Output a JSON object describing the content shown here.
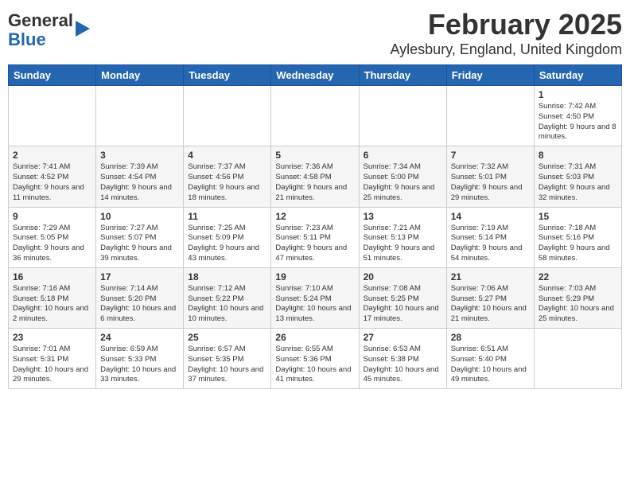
{
  "logo": {
    "general": "General",
    "blue": "Blue"
  },
  "title": "February 2025",
  "subtitle": "Aylesbury, England, United Kingdom",
  "headers": [
    "Sunday",
    "Monday",
    "Tuesday",
    "Wednesday",
    "Thursday",
    "Friday",
    "Saturday"
  ],
  "weeks": [
    [
      {
        "day": "",
        "detail": ""
      },
      {
        "day": "",
        "detail": ""
      },
      {
        "day": "",
        "detail": ""
      },
      {
        "day": "",
        "detail": ""
      },
      {
        "day": "",
        "detail": ""
      },
      {
        "day": "",
        "detail": ""
      },
      {
        "day": "1",
        "detail": "Sunrise: 7:42 AM\nSunset: 4:50 PM\nDaylight: 9 hours and 8 minutes."
      }
    ],
    [
      {
        "day": "2",
        "detail": "Sunrise: 7:41 AM\nSunset: 4:52 PM\nDaylight: 9 hours and 11 minutes."
      },
      {
        "day": "3",
        "detail": "Sunrise: 7:39 AM\nSunset: 4:54 PM\nDaylight: 9 hours and 14 minutes."
      },
      {
        "day": "4",
        "detail": "Sunrise: 7:37 AM\nSunset: 4:56 PM\nDaylight: 9 hours and 18 minutes."
      },
      {
        "day": "5",
        "detail": "Sunrise: 7:36 AM\nSunset: 4:58 PM\nDaylight: 9 hours and 21 minutes."
      },
      {
        "day": "6",
        "detail": "Sunrise: 7:34 AM\nSunset: 5:00 PM\nDaylight: 9 hours and 25 minutes."
      },
      {
        "day": "7",
        "detail": "Sunrise: 7:32 AM\nSunset: 5:01 PM\nDaylight: 9 hours and 29 minutes."
      },
      {
        "day": "8",
        "detail": "Sunrise: 7:31 AM\nSunset: 5:03 PM\nDaylight: 9 hours and 32 minutes."
      }
    ],
    [
      {
        "day": "9",
        "detail": "Sunrise: 7:29 AM\nSunset: 5:05 PM\nDaylight: 9 hours and 36 minutes."
      },
      {
        "day": "10",
        "detail": "Sunrise: 7:27 AM\nSunset: 5:07 PM\nDaylight: 9 hours and 39 minutes."
      },
      {
        "day": "11",
        "detail": "Sunrise: 7:25 AM\nSunset: 5:09 PM\nDaylight: 9 hours and 43 minutes."
      },
      {
        "day": "12",
        "detail": "Sunrise: 7:23 AM\nSunset: 5:11 PM\nDaylight: 9 hours and 47 minutes."
      },
      {
        "day": "13",
        "detail": "Sunrise: 7:21 AM\nSunset: 5:13 PM\nDaylight: 9 hours and 51 minutes."
      },
      {
        "day": "14",
        "detail": "Sunrise: 7:19 AM\nSunset: 5:14 PM\nDaylight: 9 hours and 54 minutes."
      },
      {
        "day": "15",
        "detail": "Sunrise: 7:18 AM\nSunset: 5:16 PM\nDaylight: 9 hours and 58 minutes."
      }
    ],
    [
      {
        "day": "16",
        "detail": "Sunrise: 7:16 AM\nSunset: 5:18 PM\nDaylight: 10 hours and 2 minutes."
      },
      {
        "day": "17",
        "detail": "Sunrise: 7:14 AM\nSunset: 5:20 PM\nDaylight: 10 hours and 6 minutes."
      },
      {
        "day": "18",
        "detail": "Sunrise: 7:12 AM\nSunset: 5:22 PM\nDaylight: 10 hours and 10 minutes."
      },
      {
        "day": "19",
        "detail": "Sunrise: 7:10 AM\nSunset: 5:24 PM\nDaylight: 10 hours and 13 minutes."
      },
      {
        "day": "20",
        "detail": "Sunrise: 7:08 AM\nSunset: 5:25 PM\nDaylight: 10 hours and 17 minutes."
      },
      {
        "day": "21",
        "detail": "Sunrise: 7:06 AM\nSunset: 5:27 PM\nDaylight: 10 hours and 21 minutes."
      },
      {
        "day": "22",
        "detail": "Sunrise: 7:03 AM\nSunset: 5:29 PM\nDaylight: 10 hours and 25 minutes."
      }
    ],
    [
      {
        "day": "23",
        "detail": "Sunrise: 7:01 AM\nSunset: 5:31 PM\nDaylight: 10 hours and 29 minutes."
      },
      {
        "day": "24",
        "detail": "Sunrise: 6:59 AM\nSunset: 5:33 PM\nDaylight: 10 hours and 33 minutes."
      },
      {
        "day": "25",
        "detail": "Sunrise: 6:57 AM\nSunset: 5:35 PM\nDaylight: 10 hours and 37 minutes."
      },
      {
        "day": "26",
        "detail": "Sunrise: 6:55 AM\nSunset: 5:36 PM\nDaylight: 10 hours and 41 minutes."
      },
      {
        "day": "27",
        "detail": "Sunrise: 6:53 AM\nSunset: 5:38 PM\nDaylight: 10 hours and 45 minutes."
      },
      {
        "day": "28",
        "detail": "Sunrise: 6:51 AM\nSunset: 5:40 PM\nDaylight: 10 hours and 49 minutes."
      },
      {
        "day": "",
        "detail": ""
      }
    ]
  ]
}
